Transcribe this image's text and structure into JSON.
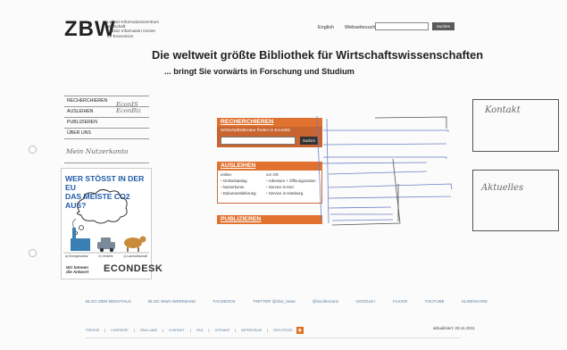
{
  "header": {
    "logo_mark": "ZBW",
    "logo_text": [
      "Leibniz-Informationszentrum",
      "Wirtschaft",
      "Leibniz Information Centre",
      "for Economics"
    ],
    "language_link": "English",
    "site_search_label": "Webseitesuche:",
    "site_search_button": "Suchen",
    "headline": "Die weltweit größte Bibliothek für Wirtschaftswissenschaften",
    "subheadline": "... bringt Sie vorwärts in Forschung und Studium"
  },
  "nav": {
    "items": [
      {
        "label": "RECHERCHIEREN"
      },
      {
        "label": "AUSLEIHEN"
      },
      {
        "label": "PUBLIZIEREN"
      },
      {
        "label": "ÜBER UNS"
      }
    ],
    "handwritten_note": [
      "EconIS",
      "EconBiz"
    ],
    "handwritten_extra": "Mein Nutzerkonto"
  },
  "ad": {
    "headline_lines": [
      "WER STÖSST IN DER EU",
      "DAS MEISTE CO2 AUS?"
    ],
    "caption_items": [
      "a) Energiesektor",
      "b) Verkehr",
      "c) Landwirtschaft"
    ],
    "tagline_lines": [
      "Wir können",
      "die Antwort"
    ],
    "brand": "ECONDESK"
  },
  "center": {
    "recherchieren": {
      "heading": "RECHERCHIEREN",
      "search_label": "Wirtschaftsliteratur finden  in EconBiz",
      "search_button": "Suchen"
    },
    "ausleihen": {
      "heading": "AUSLEIHEN",
      "col1_title": "online:",
      "col1_items": [
        "Onlinekatalog",
        "Nutzerkonto",
        "Dokumentlieferung"
      ],
      "col2_title": "vor Ort:",
      "col2_items": [
        "Adressen + Öffnungszeiten",
        "Service in Kiel",
        "Service in Hamburg"
      ]
    },
    "publizieren": {
      "heading": "PUBLIZIEREN"
    }
  },
  "sidebar_boxes": {
    "kontakt": "Kontakt",
    "aktuelles": "Aktuelles"
  },
  "footer": {
    "links": [
      "BLOG ZBW MEDIATALK",
      "BLOG WWA-WERKBANK",
      "FACEBOOK",
      "TWITTER @zbw_news",
      "@kochlemann",
      "GOOGLE+",
      "FLICKR",
      "YOUTUBE",
      "SLIDESHARE"
    ],
    "meta_links": [
      "PRESSE",
      "KARRIERE",
      "ZBW-LABS",
      "KONTAKT",
      "FAQ",
      "SITEMAP",
      "IMPRESSUM",
      "RSS-FEEDS"
    ],
    "updated": "aktualisiert: 28.11.2011"
  },
  "colors": {
    "accent_orange": "#e0712e",
    "sketch_blue": "#6b7fc4",
    "link_blue": "#5a7e9e"
  }
}
